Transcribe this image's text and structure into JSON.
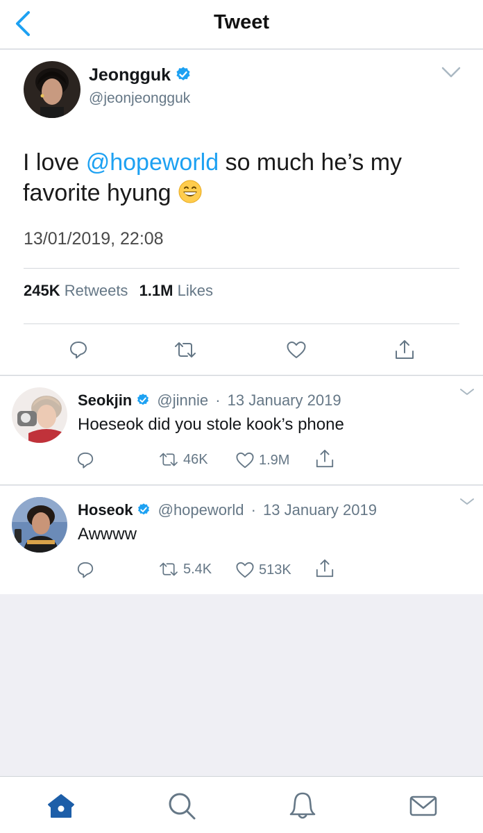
{
  "header": {
    "title": "Tweet",
    "back_icon": "chevron-left-icon"
  },
  "main_tweet": {
    "author_name": "Jeongguk",
    "author_handle": "@jeonjeongguk",
    "text_part1": "I love ",
    "mention": "@hopeworld",
    "text_part2": " so much he’s my favorite hyung ",
    "emoji": "grinning-face-emoji",
    "timestamp": "13/01/2019, 22:08",
    "retweets_count": "245K",
    "retweets_label": "Retweets",
    "likes_count": "1.1M",
    "likes_label": "Likes",
    "accent_color": "#1da1f2"
  },
  "replies": [
    {
      "name": "Seokjin",
      "handle": "@jinnie",
      "separator": "·",
      "date": "13 January 2019",
      "text": "Hoeseok did you stole kook’s phone",
      "retweets": "46K",
      "likes": "1.9M"
    },
    {
      "name": "Hoseok",
      "handle": "@hopeworld",
      "separator": "·",
      "date": "13 January 2019",
      "text": "Awwww",
      "retweets": "5.4K",
      "likes": "513K"
    }
  ],
  "tabbar": {
    "items": [
      "home-icon",
      "search-icon",
      "notifications-icon",
      "messages-icon"
    ],
    "active_color": "#1d5ea8"
  }
}
